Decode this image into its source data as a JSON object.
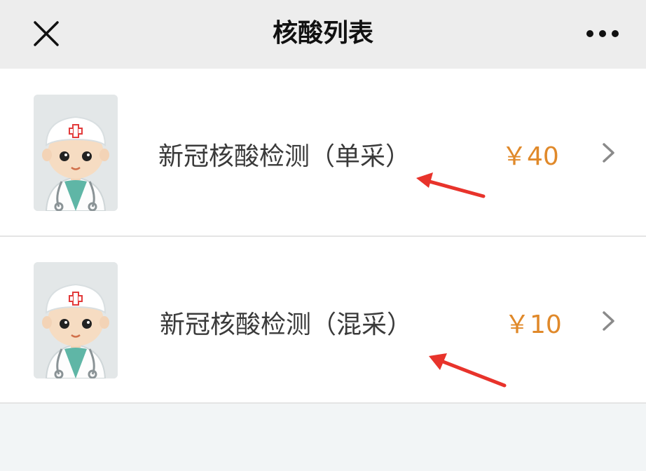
{
  "nav": {
    "title": "核酸列表",
    "close_icon": "close-icon",
    "more_icon": "more-dots-icon"
  },
  "items": [
    {
      "name": "新冠核酸检测（单采）",
      "price": "￥40",
      "avatar_icon": "doctor-avatar"
    },
    {
      "name": "新冠核酸检测（混采）",
      "price": "￥10",
      "avatar_icon": "doctor-avatar"
    }
  ],
  "colors": {
    "header_bg": "#ededed",
    "price": "#e0892a",
    "annotation_arrow": "#e8332b",
    "page_bg": "#f2f5f6"
  }
}
